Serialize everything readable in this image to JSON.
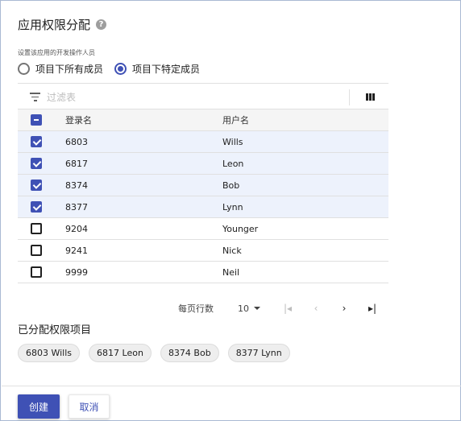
{
  "dialog": {
    "title": "应用权限分配",
    "help_icon_glyph": "?",
    "field_label": "设置该应用的开发操作人员",
    "radio_options": [
      {
        "label": "项目下所有成员",
        "checked": false
      },
      {
        "label": "项目下特定成员",
        "checked": true
      }
    ]
  },
  "filter": {
    "placeholder": "过滤表",
    "value": ""
  },
  "table": {
    "headers": {
      "login": "登录名",
      "user": "用户名"
    },
    "select_all_state": "indeterminate",
    "rows": [
      {
        "login": "6803",
        "user": "Wills",
        "checked": true
      },
      {
        "login": "6817",
        "user": "Leon",
        "checked": true
      },
      {
        "login": "8374",
        "user": "Bob",
        "checked": true
      },
      {
        "login": "8377",
        "user": "Lynn",
        "checked": true
      },
      {
        "login": "9204",
        "user": "Younger",
        "checked": false
      },
      {
        "login": "9241",
        "user": "Nick",
        "checked": false
      },
      {
        "login": "9999",
        "user": "Neil",
        "checked": false
      }
    ]
  },
  "pagination": {
    "rows_per_page_label": "每页行数",
    "rows_per_page": "10",
    "first_glyph": "|◂",
    "prev_glyph": "‹",
    "next_glyph": "›",
    "last_glyph": "▸|"
  },
  "assigned": {
    "title": "已分配权限项目",
    "chips": [
      "6803 Wills",
      "6817 Leon",
      "8374 Bob",
      "8377 Lynn"
    ]
  },
  "actions": {
    "create_label": "创建",
    "cancel_label": "取消"
  },
  "colors": {
    "primary": "#3f51b5",
    "selected_row": "#edf2fc"
  }
}
